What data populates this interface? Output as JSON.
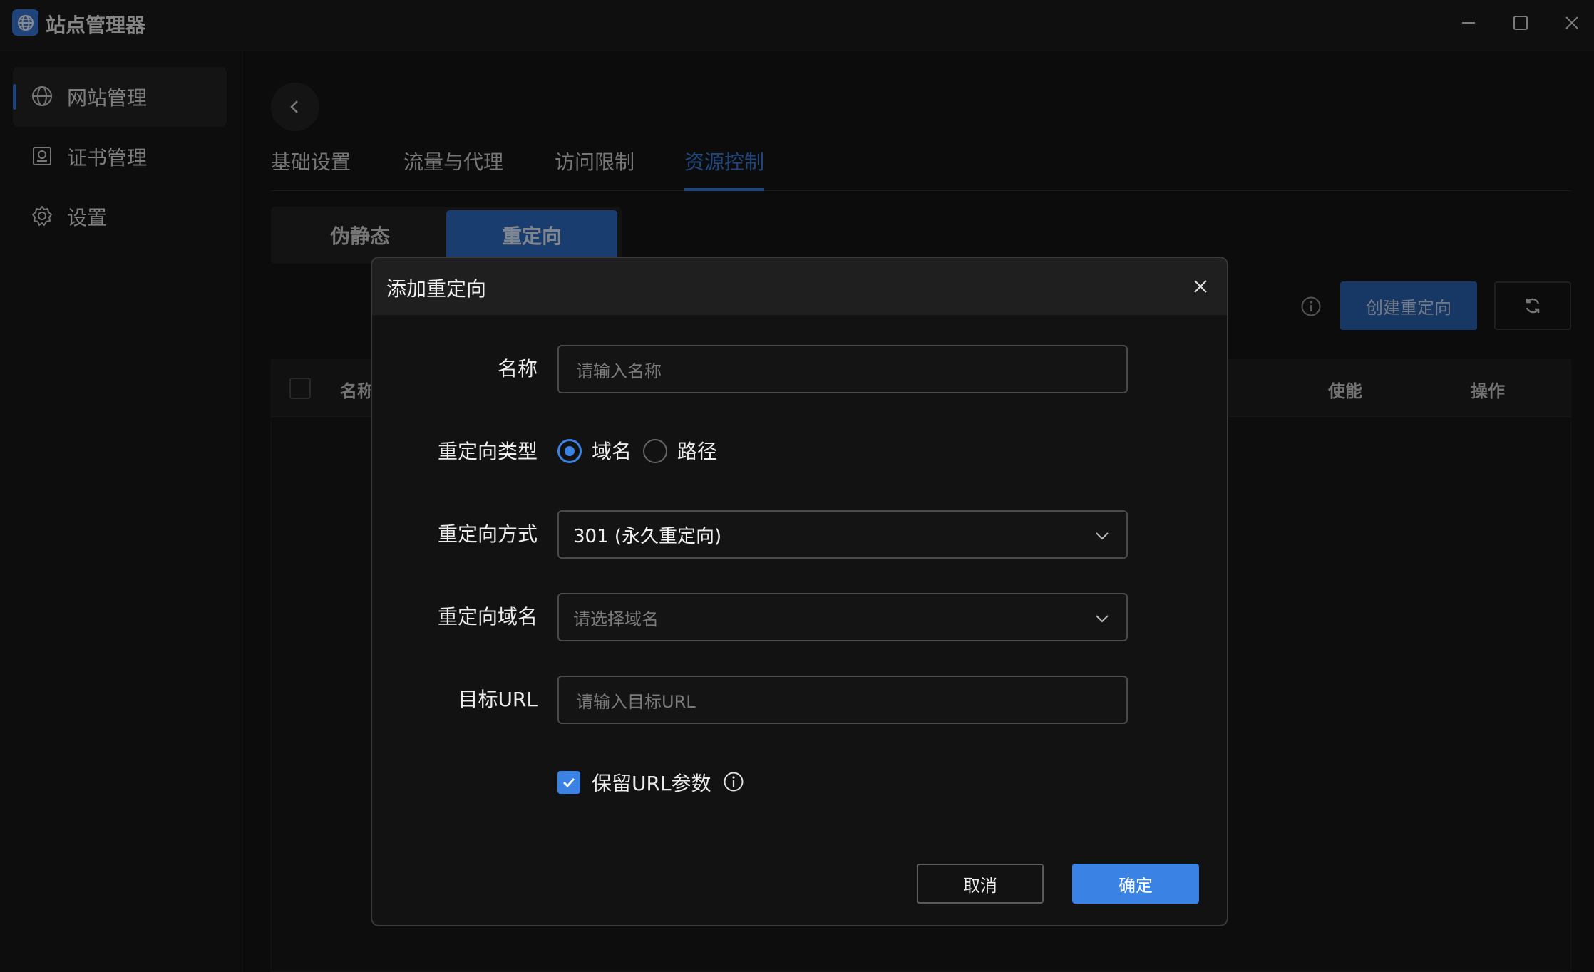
{
  "app": {
    "title": "站点管理器"
  },
  "sidebar": {
    "items": [
      {
        "label": "网站管理",
        "icon": "globe-icon",
        "active": true
      },
      {
        "label": "证书管理",
        "icon": "certificate-icon",
        "active": false
      },
      {
        "label": "设置",
        "icon": "gear-icon",
        "active": false
      }
    ]
  },
  "tabs": [
    {
      "label": "基础设置"
    },
    {
      "label": "流量与代理"
    },
    {
      "label": "访问限制"
    },
    {
      "label": "资源控制",
      "active": true
    }
  ],
  "segments": [
    {
      "label": "伪静态"
    },
    {
      "label": "重定向",
      "active": true
    }
  ],
  "toolbar": {
    "create_label": "创建重定向"
  },
  "table": {
    "columns": [
      "名称",
      "使能",
      "操作"
    ]
  },
  "dialog": {
    "title": "添加重定向",
    "fields": {
      "name": {
        "label": "名称",
        "placeholder": "请输入名称"
      },
      "type": {
        "label": "重定向类型",
        "options": [
          "域名",
          "路径"
        ],
        "selected": "域名"
      },
      "method": {
        "label": "重定向方式",
        "value": "301 (永久重定向)"
      },
      "domain": {
        "label": "重定向域名",
        "placeholder": "请选择域名"
      },
      "target": {
        "label": "目标URL",
        "placeholder": "请输入目标URL"
      }
    },
    "keep_params": {
      "label": "保留URL参数",
      "checked": true
    },
    "cancel_label": "取消",
    "ok_label": "确定"
  },
  "colors": {
    "accent": "#3a82e4",
    "background": "#141414"
  }
}
